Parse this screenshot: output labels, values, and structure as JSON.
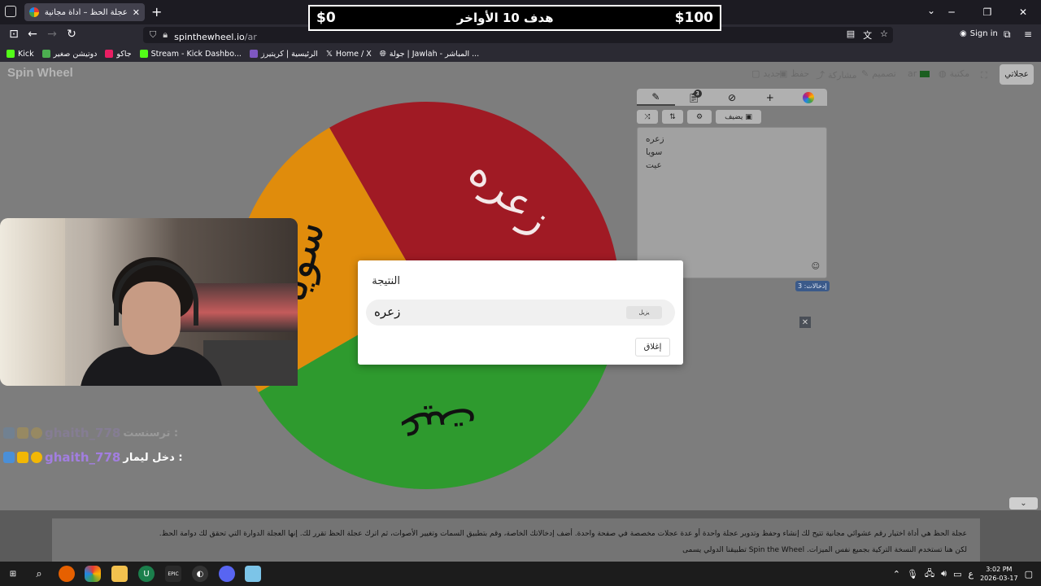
{
  "browser": {
    "tab_title": "عجلة الحظ – أداة مجانية للتدوير ع",
    "url_host": "spinthewheel.io",
    "url_path": "/ar",
    "sign_in": "Sign in",
    "bookmarks": [
      {
        "label": "Kick",
        "color": "#53fc18"
      },
      {
        "label": "دوتيشن صغير",
        "color": "#4caf50"
      },
      {
        "label": "جاكو",
        "color": "#e91e63"
      },
      {
        "label": "Stream - Kick Dashbo...",
        "color": "#53fc18"
      },
      {
        "label": "الرئيسية | كريتيرز",
        "color": "#7e57c2"
      },
      {
        "label": "Home / X",
        "color": "#000000"
      },
      {
        "label": "جولة | Jawlah - المباشر ...",
        "color": "#9e9e9e"
      }
    ]
  },
  "goal": {
    "left_value": "$0",
    "title": "هدف 10 الأواخر",
    "right_value": "$100"
  },
  "site": {
    "logo": "Spin Wheel",
    "menu": [
      "جديد",
      "حفظ",
      "مشاركة",
      "تصميم",
      "ar",
      "مكتبة"
    ],
    "my_wheels": "عجلاتي"
  },
  "wheel": {
    "segments": [
      {
        "label": "زعره",
        "color": "#a01a24",
        "text_color": "#f4e9e9",
        "start": -30,
        "end": 110
      },
      {
        "label": "عيت",
        "color": "#2e9a2e",
        "text_color": "#111111",
        "start": 110,
        "end": 240
      },
      {
        "label": "سويا",
        "color": "#e08c0c",
        "text_color": "#111111",
        "start": 240,
        "end": 330
      }
    ]
  },
  "editor": {
    "tabs": [
      "edit-icon",
      "clipboard-icon",
      "hide-icon",
      "add-icon",
      "color-icon"
    ],
    "clipboard_badge": "3",
    "add_image_label": "يضيف",
    "entries": [
      "زعره",
      "سويا",
      "عيت"
    ],
    "entries_count": "إدخالات: 3"
  },
  "chat": {
    "faded_prefix": "ترسنست :",
    "faded_name": "ghaith_778",
    "name": "ghaith_778",
    "message": "دخل ليمار :"
  },
  "modal": {
    "title": "النتيجة",
    "result": "زعره",
    "remove_label": "يزيل",
    "close_label": "إغلاق"
  },
  "description": {
    "line1": "عجلة الحظ هي أداة اختيار رقم عشوائي مجانية تتيح لك إنشاء وحفظ وتدوير عجلة واحدة أو عدة عجلات مخصصة في صفحة واحدة. أضف إدخالاتك الخاصة، وقم بتطبيق السمات وتغيير الأصوات، ثم اترك عجلة الحظ تقرر لك. إنها العجلة الدوارة التي تحقق لك دوامة الحظ.",
    "line2": "لكن هنا تستخدم النسخة التركية بجميع نفس الميزات. Spin the Wheel تطبيقنا الدولي يسمى"
  },
  "taskbar": {
    "time": "3:02 PM",
    "date": "2026-03-17",
    "lang": "ع"
  }
}
